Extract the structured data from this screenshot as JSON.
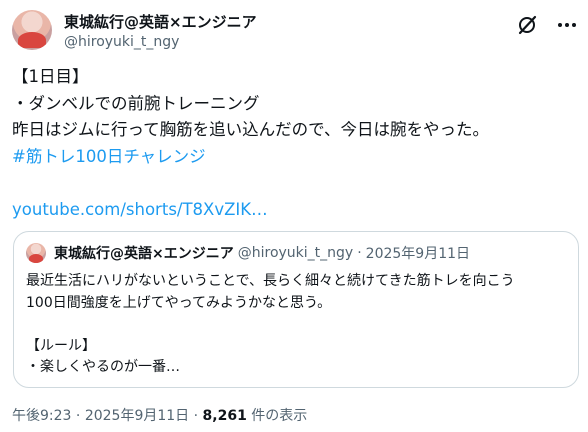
{
  "author": {
    "name": "東城紘行@英語×エンジニア",
    "handle": "@hiroyuki_t_ngy"
  },
  "header_icons": [
    "grok-icon",
    "more-icon"
  ],
  "post": {
    "lines": [
      "【1日目】",
      "・ダンベルでの前腕トレーニング",
      "昨日はジムに行って胸筋を追い込んだので、今日は腕をやった。"
    ],
    "hashtag": "#筋トレ100日チャレンジ",
    "link": "youtube.com/shorts/T8XvZIK…"
  },
  "quote": {
    "name": "東城紘行@英語×エンジニア",
    "handle": "@hiroyuki_t_ngy",
    "separator": "·",
    "date": "2025年9月11日",
    "lines": [
      "最近生活にハリがないということで、長らく細々と続けてきた筋トレを向こう",
      "100日間強度を上げてやってみようかなと思う。",
      "",
      "【ルール】",
      "・楽しくやるのが一番…"
    ]
  },
  "meta": {
    "time": "午後9:23",
    "separator1": " · ",
    "date": "2025年9月11日",
    "separator2": " · ",
    "views": "8,261",
    "views_label": " 件の表示"
  },
  "colors": {
    "link": "#1d9bf0",
    "text": "#0f1419",
    "muted": "#536471",
    "border": "#cfd9de"
  }
}
